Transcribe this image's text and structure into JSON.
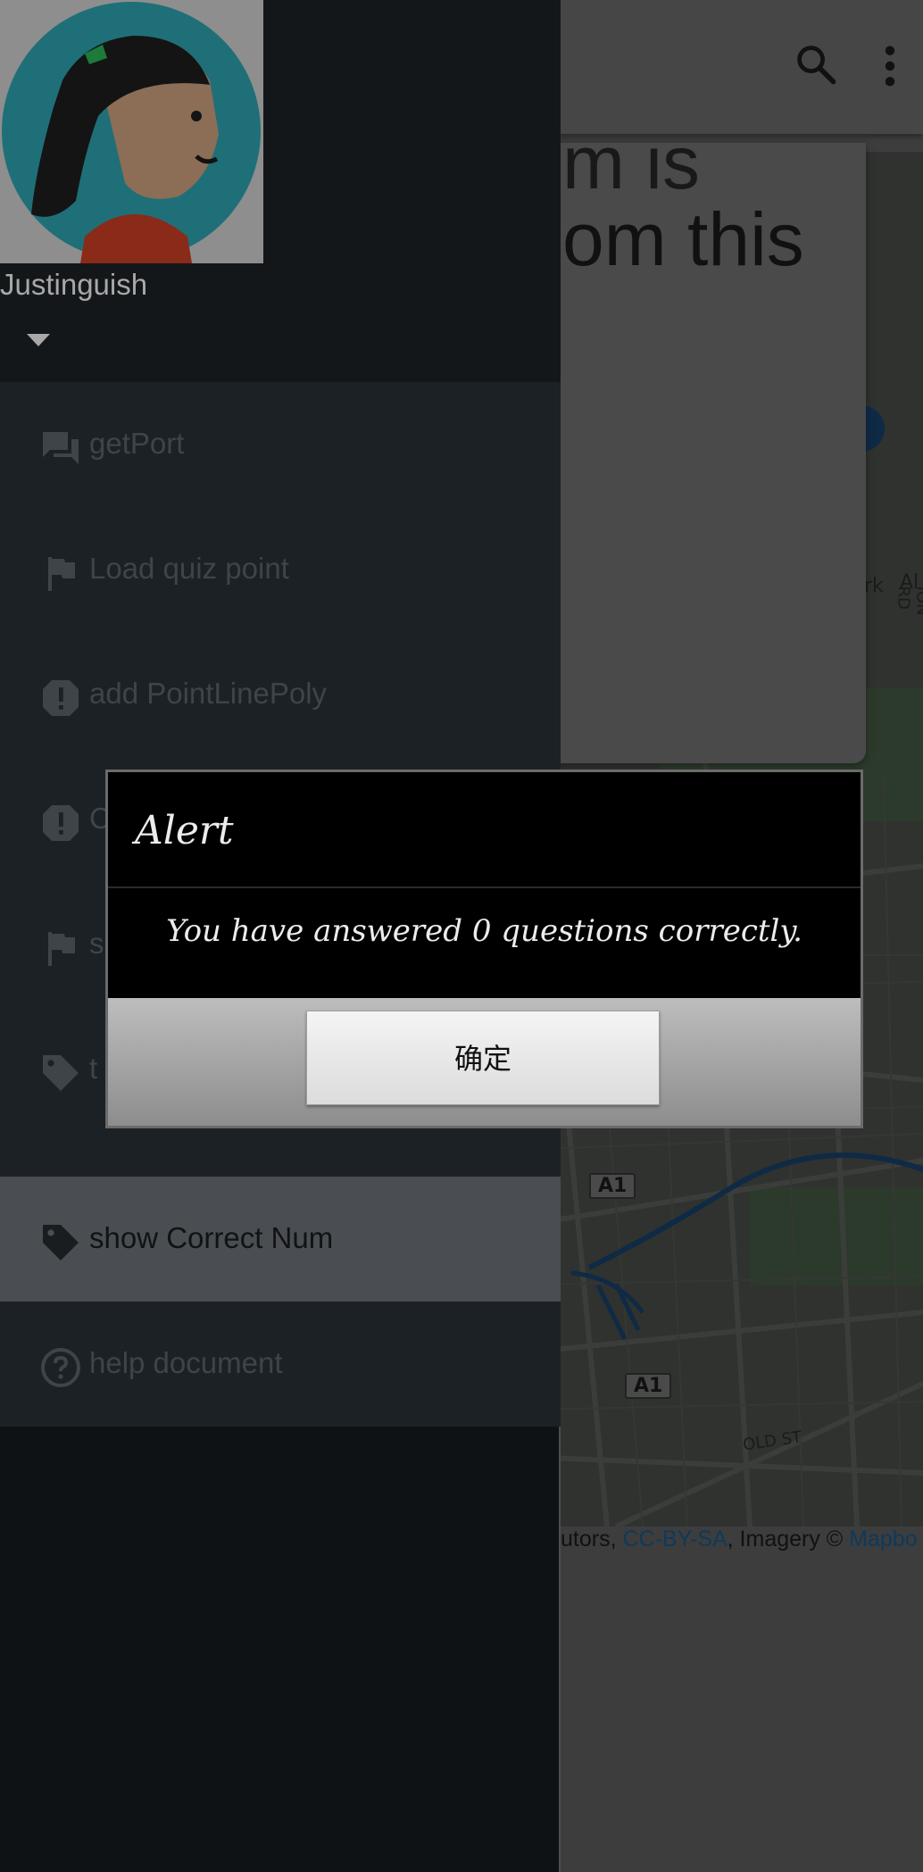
{
  "app": {
    "card_title_lines": [
      "m is",
      "om this"
    ],
    "map_labels": {
      "park": "rk",
      "road": "ION RD",
      "side": "Al",
      "old_st": "OLD ST",
      "a1_top": "A1",
      "a1_bottom": "A1"
    },
    "attribution": {
      "prefix": "utors, ",
      "license": "CC-BY-SA",
      "imagery": ", Imagery © ",
      "provider": "Mapbo"
    }
  },
  "drawer": {
    "user_name": "Justinguish",
    "menu_items": [
      {
        "label": "getPort",
        "icon": "forum-icon"
      },
      {
        "label": "Load quiz point",
        "icon": "flag-icon"
      },
      {
        "label": "add PointLinePoly",
        "icon": "alert-icon"
      },
      {
        "label": "C",
        "icon": "alert-icon"
      },
      {
        "label": "s",
        "icon": "flag-icon"
      },
      {
        "label": "t",
        "icon": "tag-icon"
      },
      {
        "label": "show Correct Num",
        "icon": "tag-icon"
      },
      {
        "label": "help document",
        "icon": "help-icon"
      }
    ]
  },
  "dialog": {
    "title": "Alert",
    "message": "You have answered 0 questions correctly.",
    "ok_label": "确定"
  },
  "colors": {
    "drawer_bg": "#1c2126",
    "active_item": "#4a4e52",
    "dialog_bg": "#000000",
    "link": "#0d3a5c"
  }
}
